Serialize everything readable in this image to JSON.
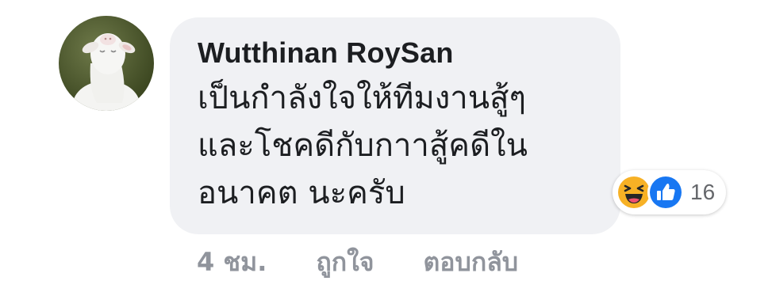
{
  "comment": {
    "author": "Wutthinan RoySan",
    "text": "เป็นกำลังใจให้ทีมงานสู้ๆ\nและโชคดีกับกาาสู้คดีใน\nอนาคต นะครับ",
    "avatar_icon": "goat-avatar-icon"
  },
  "reactions": {
    "icons": [
      "haha-emoji-icon",
      "like-thumb-icon"
    ],
    "count": "16",
    "colors": {
      "like": "#1877f2",
      "haha": "#f7b125"
    }
  },
  "actions": {
    "time": "4 ชม.",
    "like_label": "ถูกใจ",
    "reply_label": "ตอบกลับ"
  }
}
